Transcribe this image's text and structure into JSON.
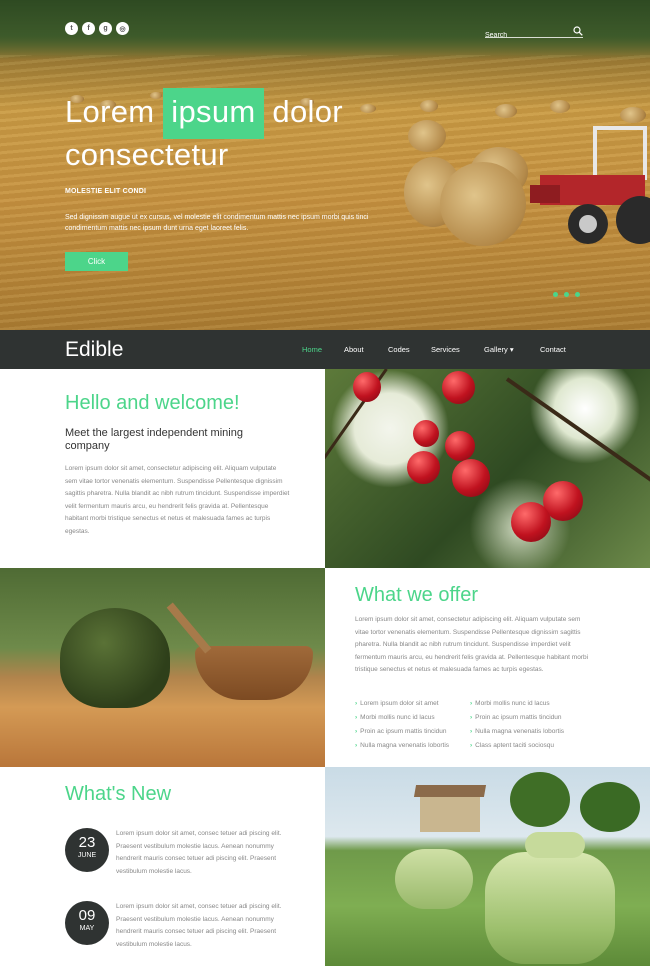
{
  "hero": {
    "social_icons": [
      "twitter-icon",
      "facebook-icon",
      "google-plus-icon",
      "dribbble-icon"
    ],
    "search": {
      "placeholder": "Search"
    },
    "title_part1": "Lorem",
    "title_highlight": "ipsum",
    "title_part2": "dolor",
    "title_line2": "consectetur",
    "subtitle": "MOLESTIE ELIT CONDI",
    "description": "Sed dignissim augue ut ex cursus, vel molestie elit condimentum mattis nec ipsum morbi quis tinci condimentum mattis nec ipsum dunt urna eget laoreet felis.",
    "button_label": "Click",
    "slider_dots": 3
  },
  "nav": {
    "logo": "Edible",
    "items": [
      "Home",
      "About",
      "Codes",
      "Services",
      "Gallery ▾",
      "Contact"
    ],
    "active": "Home"
  },
  "welcome": {
    "title": "Hello and welcome!",
    "lead": "Meet the largest independent mining company",
    "body": "Lorem ipsum dolor sit amet, consectetur adipiscing elit. Aliquam vulputate sem vitae tortor venenatis elementum. Suspendisse Pellentesque dignissim sagittis pharetra. Nulla blandit ac nibh rutrum tincidunt. Suspendisse imperdiet velit fermentum mauris arcu, eu hendrerit felis gravida at. Pellentesque habitant morbi tristique senectus et netus et malesuada fames ac turpis egestas."
  },
  "offer": {
    "title": "What we offer",
    "body": "Lorem ipsum dolor sit amet, consectetur adipiscing elit. Aliquam vulputate sem vitae tortor venenatis elementum. Suspendisse Pellentesque dignissim sagittis pharetra. Nulla blandit ac nibh rutrum tincidunt. Suspendisse imperdiet velit fermentum mauris arcu, eu hendrerit felis gravida at. Pellentesque habitant morbi tristique senectus et netus et malesuada fames ac turpis egestas.",
    "features_left": [
      "Lorem ipsum dolor sit amet",
      "Morbi mollis nunc id lacus",
      "Proin ac ipsum mattis tincidun",
      "Nulla magna venenatis lobortis"
    ],
    "features_right": [
      "Morbi mollis nunc id lacus",
      "Proin ac ipsum mattis tincidun",
      "Nulla magna venenatis lobortis",
      "Class aptent taciti sociosqu"
    ]
  },
  "news": {
    "title": "What's New",
    "items": [
      {
        "day": "23",
        "month": "JUNE",
        "text": "Lorem ipsum dolor sit amet, consec tetuer adi piscing elit. Praesent vestibulum molestie lacus. Aenean nonummy hendrerit mauris consec tetuer adi piscing elit. Praesent vestibulum molestie lacus."
      },
      {
        "day": "09",
        "month": "MAY",
        "text": "Lorem ipsum dolor sit amet, consec tetuer adi piscing elit. Praesent vestibulum molestie lacus. Aenean nonummy hendrerit mauris consec tetuer adi piscing elit. Praesent vestibulum molestie lacus."
      }
    ]
  },
  "colors": {
    "accent": "#4cd58a",
    "nav_bg": "#2f3332",
    "date_badge": "#2f3332"
  }
}
